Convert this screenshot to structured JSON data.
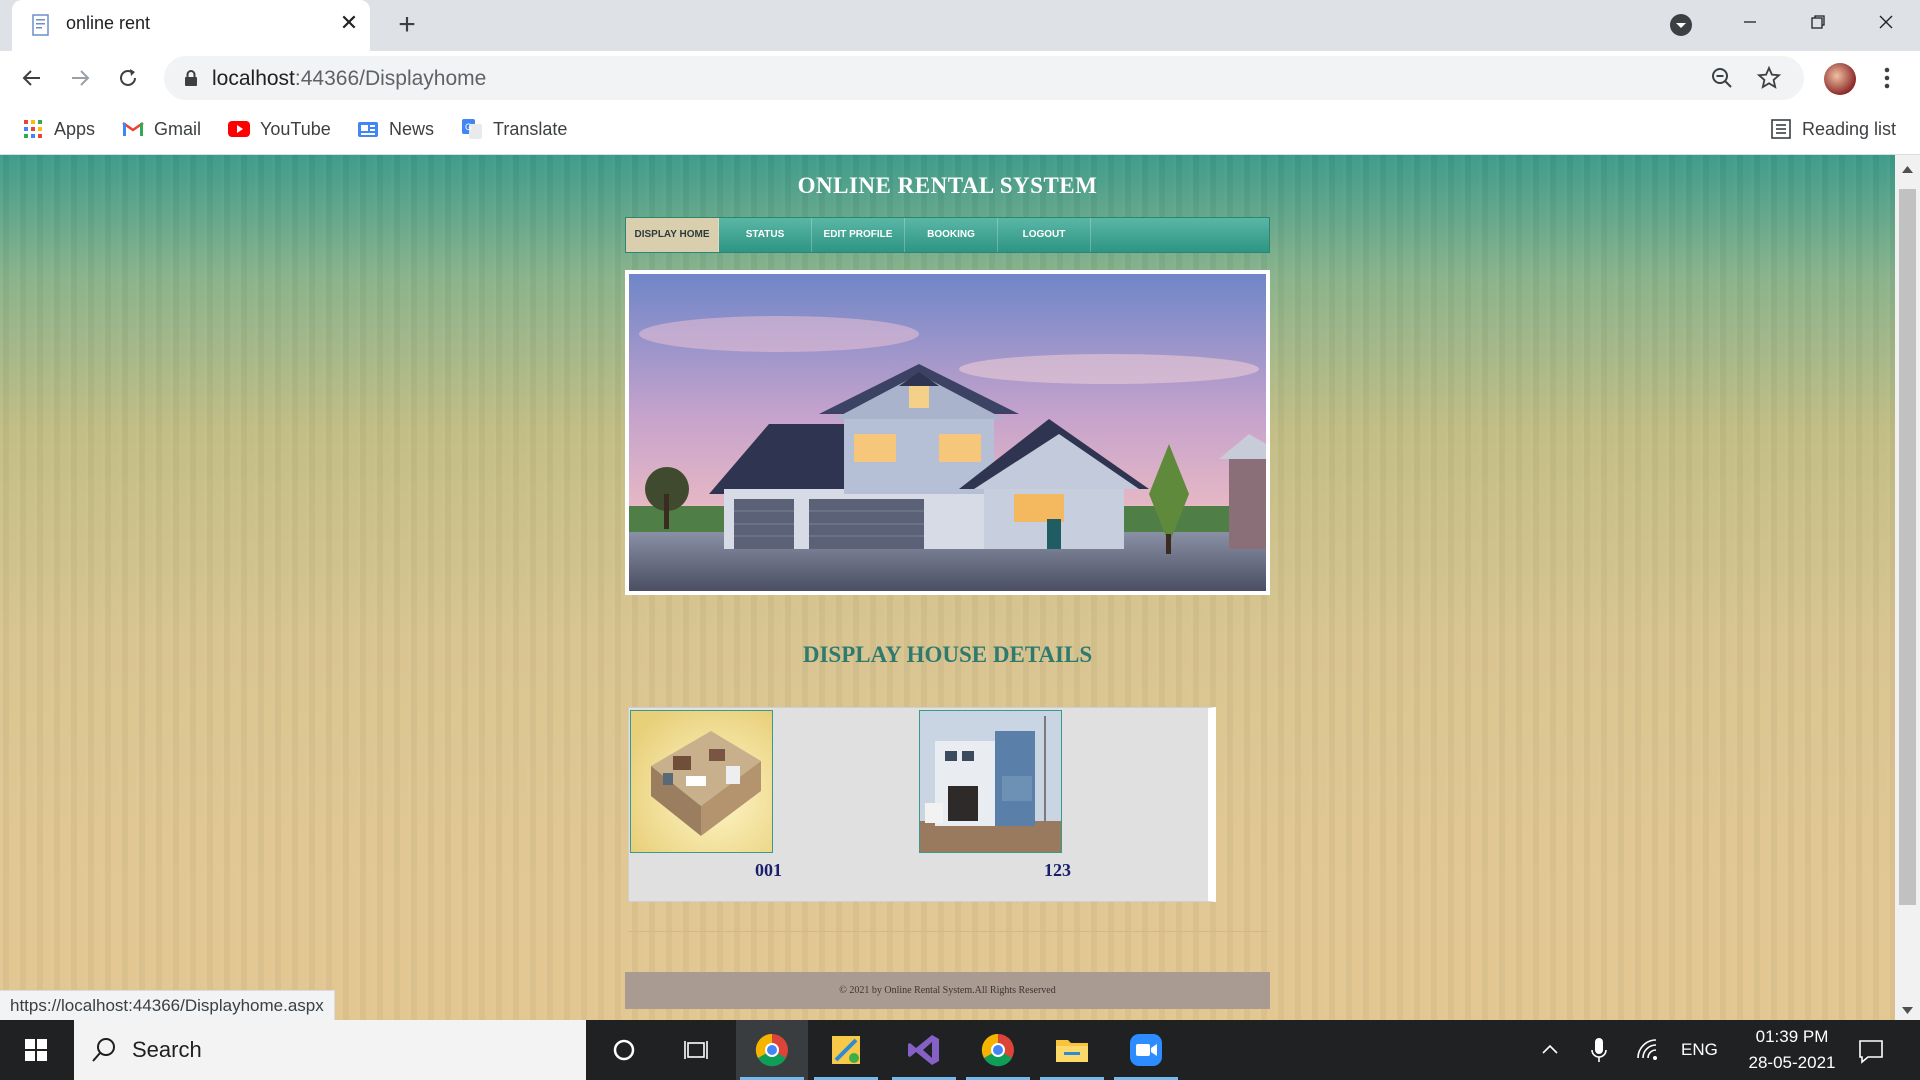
{
  "browser": {
    "tab_title": "online rent",
    "url_host": "localhost",
    "url_rest": ":44366/Displayhome",
    "bookmarks": [
      {
        "label": "Apps",
        "icon": "apps-grid-icon"
      },
      {
        "label": "Gmail",
        "icon": "gmail-icon"
      },
      {
        "label": "YouTube",
        "icon": "youtube-icon"
      },
      {
        "label": "News",
        "icon": "news-icon"
      },
      {
        "label": "Translate",
        "icon": "translate-icon"
      }
    ],
    "reading_list": "Reading list",
    "status_url": "https://localhost:44366/Displayhome.aspx"
  },
  "page": {
    "site_title": "ONLINE RENTAL SYSTEM",
    "menu": [
      "DISPLAY HOME",
      "STATUS",
      "EDIT PROFILE",
      "BOOKING",
      "LOGOUT"
    ],
    "active_menu": "DISPLAY HOME",
    "section_title": "DISPLAY HOUSE DETAILS",
    "houses": [
      {
        "id": "001",
        "thumb": "floor-plan-3d"
      },
      {
        "id": "123",
        "thumb": "house-front"
      }
    ],
    "footer": "© 2021 by Online Rental System.All Rights Reserved"
  },
  "taskbar": {
    "search_placeholder": "Search",
    "language": "ENG",
    "time": "01:39 PM",
    "date": "28-05-2021"
  },
  "colors": {
    "menu_bar": "#2e9584",
    "menu_active": "#d9cfae",
    "section_title": "#2f7a6f",
    "house_id": "#1a1f6b",
    "footer_bg": "#a99b92"
  }
}
